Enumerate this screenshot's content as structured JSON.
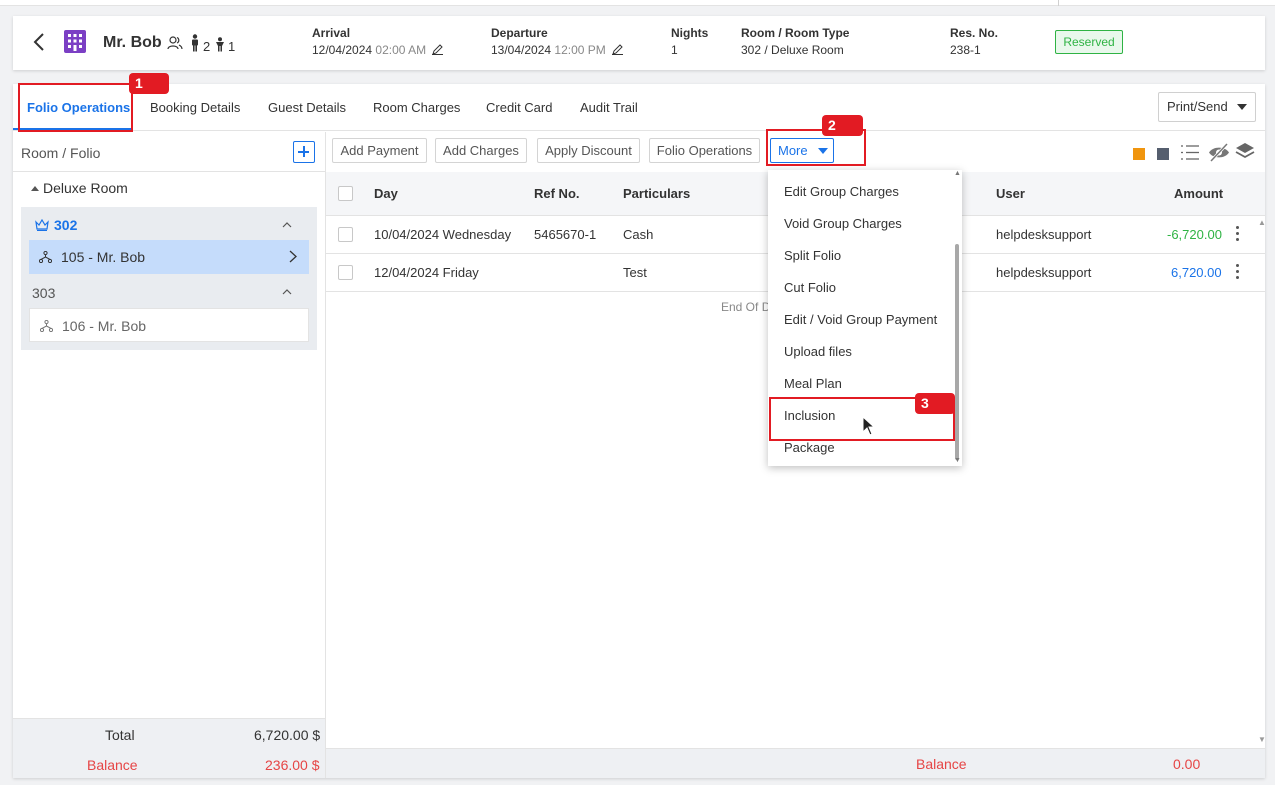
{
  "header": {
    "guest_name": "Mr. Bob",
    "adults": "2",
    "children": "1",
    "arrival_label": "Arrival",
    "arrival_date": "12/04/2024",
    "arrival_time": "02:00 AM",
    "departure_label": "Departure",
    "departure_date": "13/04/2024",
    "departure_time": "12:00 PM",
    "nights_label": "Nights",
    "nights_value": "1",
    "room_label": "Room / Room Type",
    "room_value": "302 / Deluxe Room",
    "resno_label": "Res. No.",
    "resno_value": "238-1",
    "status": "Reserved"
  },
  "tabs": [
    "Folio Operations",
    "Booking Details",
    "Guest Details",
    "Room Charges",
    "Credit Card",
    "Audit Trail"
  ],
  "print_send": "Print/Send",
  "left_panel": {
    "title": "Room / Folio",
    "room_type": "Deluxe Room",
    "rooms": [
      {
        "number": "302",
        "folio": "105 - Mr. Bob"
      },
      {
        "number": "303",
        "folio": "106 - Mr. Bob"
      }
    ],
    "total_label": "Total",
    "total_value": "6,720.00 $",
    "balance_label": "Balance",
    "balance_value": "236.00 $"
  },
  "toolbar": {
    "add_payment": "Add Payment",
    "add_charges": "Add Charges",
    "apply_discount": "Apply Discount",
    "folio_operations": "Folio Operations",
    "more": "More"
  },
  "table": {
    "columns": {
      "day": "Day",
      "ref": "Ref No.",
      "particulars": "Particulars",
      "user": "User",
      "amount": "Amount"
    },
    "rows": [
      {
        "day": "10/04/2024 Wednesday",
        "ref": "5465670-1",
        "particulars": "Cash",
        "user": "helpdesksupport",
        "amount": "-6,720.00"
      },
      {
        "day": "12/04/2024 Friday",
        "ref": "",
        "particulars": "Test",
        "user": "helpdesksupport",
        "amount": "6,720.00"
      }
    ],
    "end_text": "End Of D",
    "balance_label": "Balance",
    "balance_value": "0.00"
  },
  "dropdown": {
    "items": [
      "Edit Group Charges",
      "Void Group Charges",
      "Split Folio",
      "Cut Folio",
      "Edit / Void Group Payment",
      "Upload files",
      "Meal Plan",
      "Inclusion",
      "Package"
    ]
  },
  "annotations": [
    "1",
    "2",
    "3"
  ],
  "colors": {
    "accent": "#1a73e8",
    "positive": "#1a73e8",
    "negative": "#2fb344",
    "balance": "#e64545",
    "highlight": "#e21b23",
    "status_badge": "#2fb344"
  }
}
